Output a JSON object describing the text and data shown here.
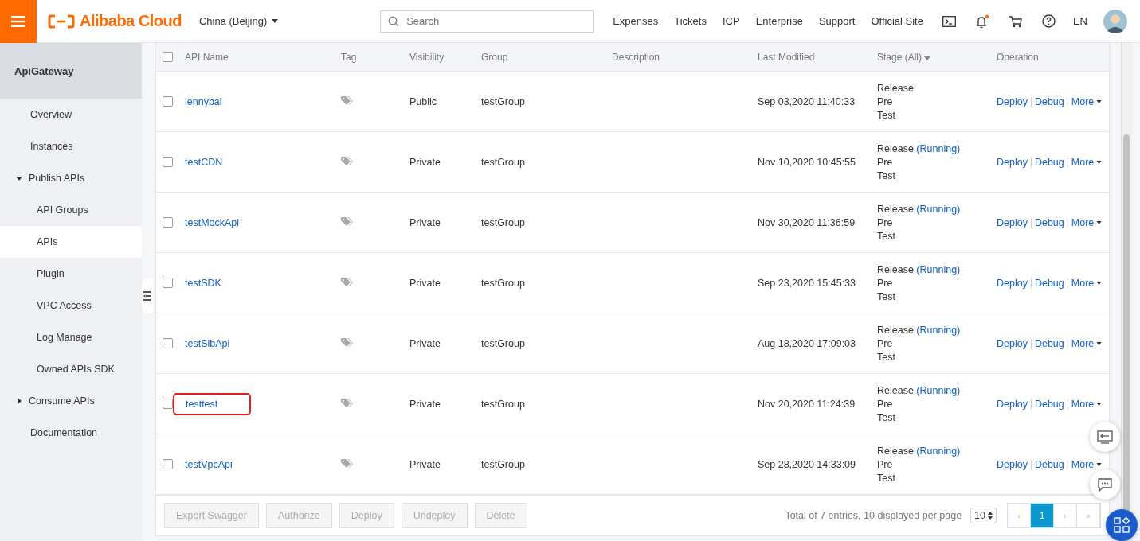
{
  "topbar": {
    "logo": "Alibaba Cloud",
    "region": "China (Beijing)",
    "search": {
      "placeholder": "Search"
    },
    "links": [
      "Expenses",
      "Tickets",
      "ICP",
      "Enterprise",
      "Support",
      "Official Site"
    ],
    "language": "EN"
  },
  "sidebar": {
    "title": "ApiGateway",
    "items": [
      {
        "label": "Overview",
        "selected": false
      },
      {
        "label": "Instances",
        "selected": false
      },
      {
        "label": "Publish APIs",
        "expanded": true,
        "selected": false,
        "children": [
          {
            "label": "API Groups",
            "selected": false
          },
          {
            "label": "APIs",
            "selected": true
          },
          {
            "label": "Plugin",
            "selected": false
          },
          {
            "label": "VPC Access",
            "selected": false
          },
          {
            "label": "Log Manage",
            "selected": false
          },
          {
            "label": "Owned APIs SDK",
            "selected": false
          }
        ]
      },
      {
        "label": "Consume APIs",
        "expanded": false,
        "selected": false
      },
      {
        "label": "Documentation",
        "selected": false
      }
    ]
  },
  "table": {
    "columns": [
      "API Name",
      "Tag",
      "Visibility",
      "Group",
      "Description",
      "Last Modified",
      "Stage (All)",
      "Operation"
    ],
    "header_checked": false,
    "rows": [
      {
        "checked": false,
        "highlighted": false,
        "name": "lennybai",
        "visibility": "Public",
        "group": "testGroup",
        "modified": "Sep 03,2020 11:40:33",
        "stages": [
          {
            "label": "Release"
          },
          {
            "label": "Pre"
          },
          {
            "label": "Test"
          }
        ],
        "operations": [
          "Deploy",
          "Debug",
          "More"
        ]
      },
      {
        "checked": false,
        "highlighted": false,
        "name": "testCDN",
        "visibility": "Private",
        "group": "testGroup",
        "modified": "Nov 10,2020 10:45:55",
        "stages": [
          {
            "label": "Release",
            "status": "(Running)"
          },
          {
            "label": "Pre"
          },
          {
            "label": "Test"
          }
        ],
        "operations": [
          "Deploy",
          "Debug",
          "More"
        ]
      },
      {
        "checked": false,
        "highlighted": false,
        "name": "testMockApi",
        "visibility": "Private",
        "group": "testGroup",
        "modified": "Nov 30,2020 11:36:59",
        "stages": [
          {
            "label": "Release",
            "status": "(Running)"
          },
          {
            "label": "Pre"
          },
          {
            "label": "Test"
          }
        ],
        "operations": [
          "Deploy",
          "Debug",
          "More"
        ]
      },
      {
        "checked": false,
        "highlighted": false,
        "name": "testSDK",
        "visibility": "Private",
        "group": "testGroup",
        "modified": "Sep 23,2020 15:45:33",
        "stages": [
          {
            "label": "Release",
            "status": "(Running)"
          },
          {
            "label": "Pre"
          },
          {
            "label": "Test"
          }
        ],
        "operations": [
          "Deploy",
          "Debug",
          "More"
        ]
      },
      {
        "checked": false,
        "highlighted": false,
        "name": "testSlbApi",
        "visibility": "Private",
        "group": "testGroup",
        "modified": "Aug 18,2020 17:09:03",
        "stages": [
          {
            "label": "Release",
            "status": "(Running)"
          },
          {
            "label": "Pre"
          },
          {
            "label": "Test"
          }
        ],
        "operations": [
          "Deploy",
          "Debug",
          "More"
        ]
      },
      {
        "checked": false,
        "highlighted": true,
        "name": "testtest",
        "visibility": "Private",
        "group": "testGroup",
        "modified": "Nov 20,2020 11:24:39",
        "stages": [
          {
            "label": "Release",
            "status": "(Running)"
          },
          {
            "label": "Pre"
          },
          {
            "label": "Test"
          }
        ],
        "operations": [
          "Deploy",
          "Debug",
          "More"
        ]
      },
      {
        "checked": false,
        "highlighted": false,
        "name": "testVpcApi",
        "visibility": "Private",
        "group": "testGroup",
        "modified": "Sep 28,2020 14:33:09",
        "stages": [
          {
            "label": "Release",
            "status": "(Running)"
          },
          {
            "label": "Pre"
          },
          {
            "label": "Test"
          }
        ],
        "operations": [
          "Deploy",
          "Debug",
          "More"
        ]
      }
    ]
  },
  "footer": {
    "buttons": [
      {
        "label": "Export Swagger",
        "disabled": true
      },
      {
        "label": "Authorize",
        "disabled": true
      },
      {
        "label": "Deploy",
        "disabled": true
      },
      {
        "label": "Undeploy",
        "disabled": true
      },
      {
        "label": "Delete",
        "disabled": true
      }
    ],
    "summary": "Total of 7 entries, 10 displayed per page",
    "page_size": "10",
    "pages": [
      {
        "label": "‹",
        "kind": "prev",
        "disabled": true
      },
      {
        "label": "1",
        "kind": "page",
        "selected": true
      },
      {
        "label": "›",
        "kind": "next",
        "disabled": true
      },
      {
        "label": "»",
        "kind": "last",
        "disabled": true
      }
    ]
  }
}
